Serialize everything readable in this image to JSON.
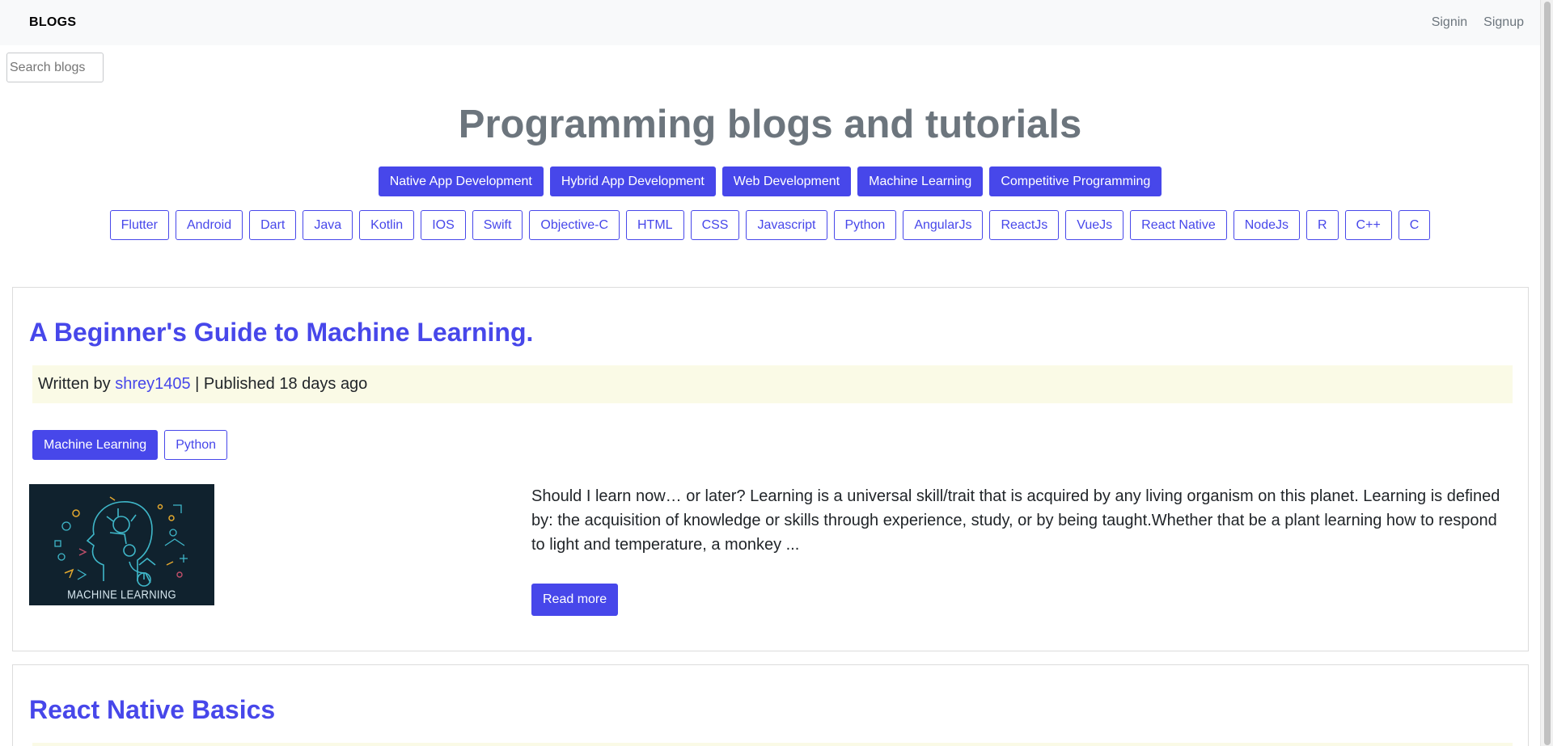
{
  "nav": {
    "brand": "BLOGS",
    "signin": "Signin",
    "signup": "Signup"
  },
  "search": {
    "placeholder": "Search blogs"
  },
  "hero": {
    "title": "Programming blogs and tutorials"
  },
  "categories": [
    "Native App Development",
    "Hybrid App Development",
    "Web Development",
    "Machine Learning",
    "Competitive Programming"
  ],
  "tags": [
    "Flutter",
    "Android",
    "Dart",
    "Java",
    "Kotlin",
    "IOS",
    "Swift",
    "Objective-C",
    "HTML",
    "CSS",
    "Javascript",
    "Python",
    "AngularJs",
    "ReactJs",
    "VueJs",
    "React Native",
    "NodeJs",
    "R",
    "C++",
    "C"
  ],
  "posts": [
    {
      "title": "A Beginner's Guide to Machine Learning.",
      "written_by": "Written by ",
      "author": "shrey1405",
      "published": " | Published 18 days ago",
      "category": "Machine Learning",
      "tag": "Python",
      "image_text": "MACHINE LEARNING",
      "excerpt": "Should I learn now… or later? Learning is a universal skill/trait that is acquired by any living organism on this planet. Learning is defined by: the acquisition of knowledge or skills through experience, study, or by being taught.Whether that be a plant learning how to respond to light and temperature, a monkey ...",
      "read_more": "Read more"
    },
    {
      "title": "React Native Basics"
    }
  ],
  "colors": {
    "accent": "#4747ea",
    "navbar_bg": "#f8f9fa",
    "title_gray": "#6c757d",
    "meta_bg": "#fafae6",
    "thumb_bg": "#10222e"
  }
}
